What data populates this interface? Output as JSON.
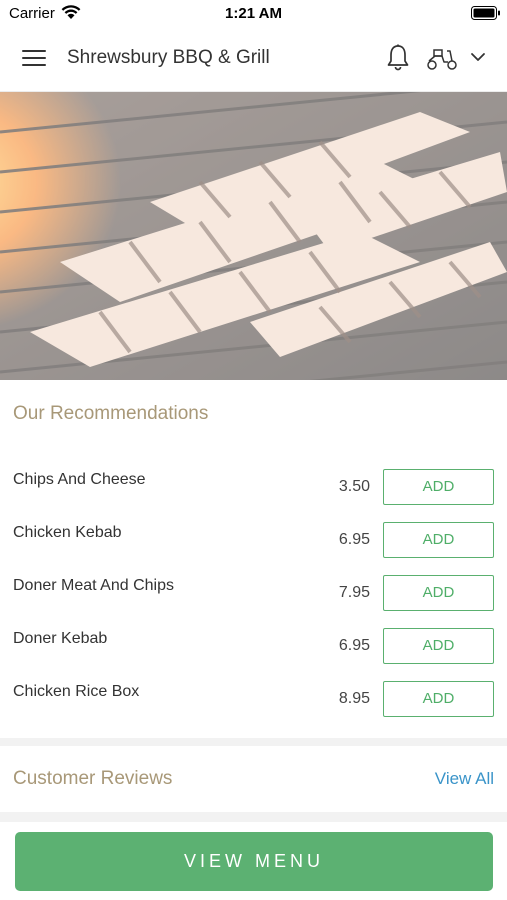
{
  "status_bar": {
    "carrier": "Carrier",
    "time": "1:21 AM"
  },
  "header": {
    "title": "Shrewsbury BBQ & Grill",
    "icons": [
      "menu-icon",
      "bell-icon",
      "scooter-icon",
      "chevron-down-icon"
    ]
  },
  "hero": {
    "image": "grilled chicken on flaming barbecue grill"
  },
  "recommendations": {
    "title": "Our Recommendations",
    "add_label": "ADD",
    "items": [
      {
        "name": "Chips And Cheese",
        "price": "3.50"
      },
      {
        "name": "Chicken Kebab",
        "price": "6.95"
      },
      {
        "name": "Doner Meat And Chips",
        "price": "7.95"
      },
      {
        "name": "Doner Kebab",
        "price": "6.95"
      },
      {
        "name": "Chicken Rice Box",
        "price": "8.95"
      }
    ]
  },
  "reviews": {
    "title": "Customer Reviews",
    "view_all": "View All"
  },
  "bottom": {
    "view_menu": "VIEW MENU"
  },
  "colors": {
    "accent_green": "#5cb172",
    "section_title": "#a89878",
    "link_blue": "#3a94c9"
  }
}
